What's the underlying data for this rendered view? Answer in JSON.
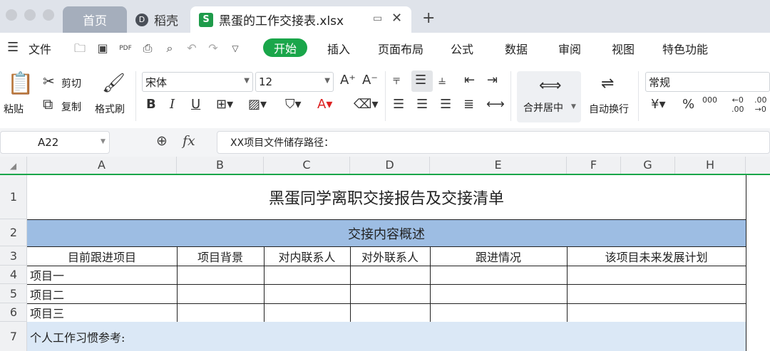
{
  "titlebar": {
    "tabs": [
      {
        "label": "首页"
      },
      {
        "label": "稻壳"
      },
      {
        "label": "黑蛋的工作交接表.xlsx"
      }
    ],
    "new_tab_icon": "plus-icon"
  },
  "menubar": {
    "file_label": "文件",
    "items": [
      "开始",
      "插入",
      "页面布局",
      "公式",
      "数据",
      "审阅",
      "视图",
      "特色功能"
    ]
  },
  "ribbon": {
    "paste": "粘贴",
    "cut": "剪切",
    "copy": "复制",
    "format_painter": "格式刷",
    "font_name": "宋体",
    "font_size": "12",
    "merge_center": "合并居中",
    "wrap_text": "自动换行",
    "number_format": "常规"
  },
  "formula_bar": {
    "cell_ref": "A22",
    "fx": "fx",
    "content": "XX项目文件储存路径："
  },
  "columns": [
    "A",
    "B",
    "C",
    "D",
    "E",
    "F",
    "G",
    "H"
  ],
  "rows": [
    "1",
    "2",
    "3",
    "4",
    "5",
    "6",
    "7"
  ],
  "sheet": {
    "title": "黑蛋同学离职交接报告及交接清单",
    "section": "交接内容概述",
    "headers": [
      "目前跟进项目",
      "项目背景",
      "对内联系人",
      "对外联系人",
      "跟进情况",
      "该项目未来发展计划"
    ],
    "items": [
      "项目一",
      "项目二",
      "项目三"
    ],
    "habits_label": "个人工作习惯参考:"
  },
  "colors": {
    "accent": "#1aa64a",
    "section_fill": "#9dbde3",
    "habits_fill": "#dbe8f6"
  }
}
